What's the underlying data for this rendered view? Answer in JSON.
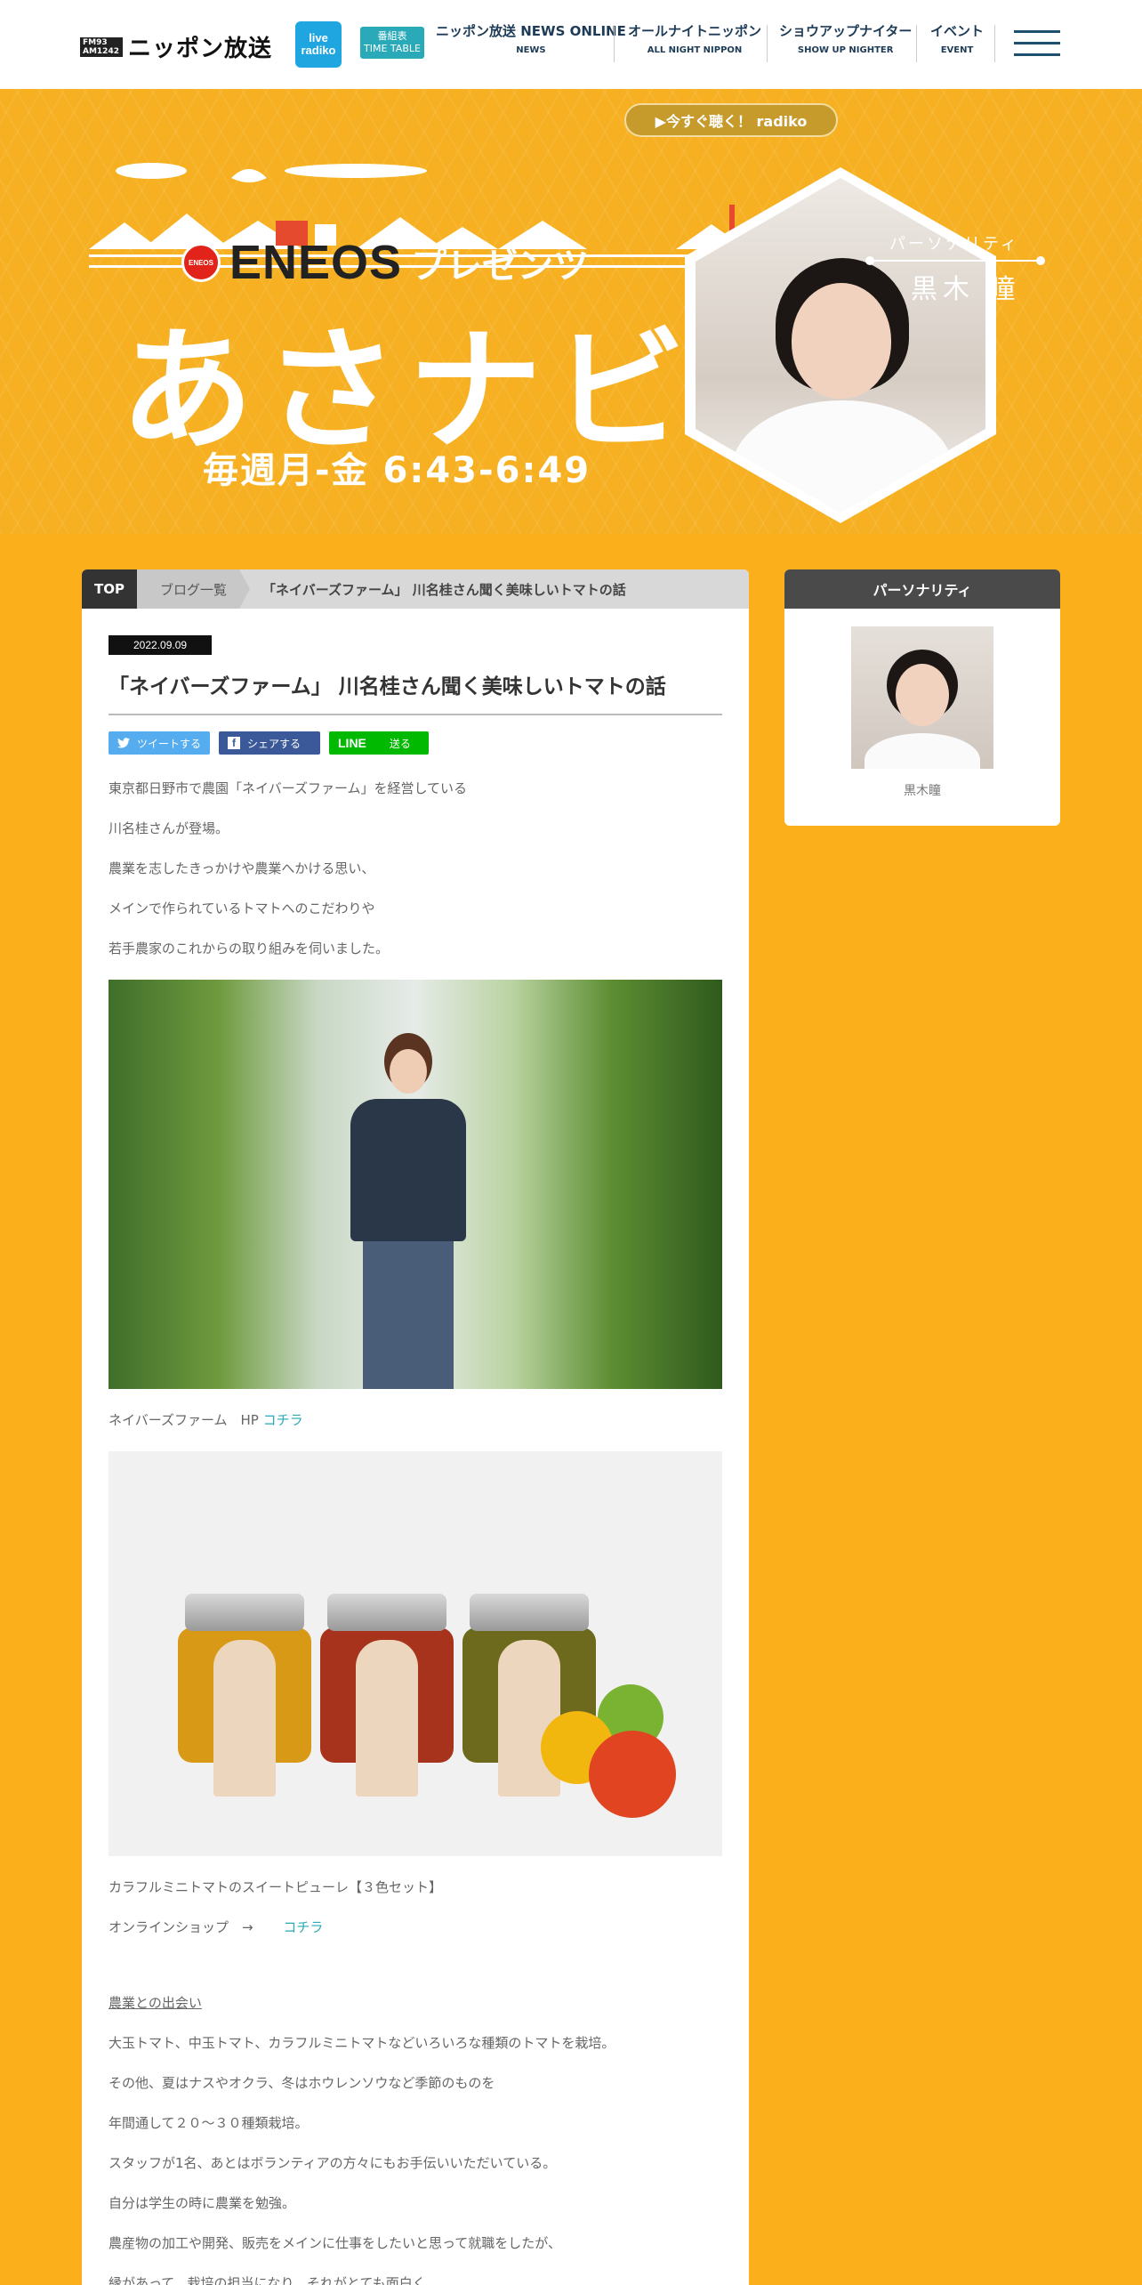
{
  "header": {
    "logo_freq": "FM93 AM1242",
    "logo_name": "ニッポン放送",
    "radiko_label": "live radiko",
    "timetable": {
      "jp": "番組表",
      "en": "TIME TABLE"
    },
    "nav": [
      {
        "jp": "ニッポン放送 NEWS ONLINE",
        "en": "NEWS"
      },
      {
        "jp": "オールナイトニッポン",
        "en": "ALL NIGHT NIPPON"
      },
      {
        "jp": "ショウアップナイター",
        "en": "SHOW UP NIGHTER"
      },
      {
        "jp": "イベント",
        "en": "EVENT"
      }
    ]
  },
  "hero": {
    "listen_button": "▶今すぐ聴く！ radiko",
    "sponsor_badge": "ENEOS",
    "sponsor": "ENEOS",
    "presents": "プレゼンツ",
    "title": "あさナビ",
    "time": "毎週月-金 6:43-6:49",
    "personality_label": "パーソナリティ",
    "personality_name": "黒木 瞳"
  },
  "breadcrumb": {
    "top": "TOP",
    "blog_list": "ブログ一覧",
    "current": "「ネイバーズファーム」 川名桂さん聞く美味しいトマトの話"
  },
  "article": {
    "date": "2022.09.09",
    "title": "「ネイバーズファーム」 川名桂さん聞く美味しいトマトの話",
    "share": {
      "twitter": "ツイートする",
      "facebook": "シェアする",
      "line": "LINE",
      "line_action": "送る"
    },
    "intro": [
      "東京都日野市で農園「ネイバーズファーム」を経営している",
      "川名桂さんが登場。",
      "農業を志したきっかけや農業へかける思い、",
      "メインで作られているトマトへのこだわりや",
      "若手農家のこれからの取り組みを伺いました。"
    ],
    "hp_text": "ネイバーズファーム　HP",
    "hp_link": "コチラ",
    "product_text": "カラフルミニトマトのスイートピューレ【３色セット】",
    "shop_text": "オンラインショップ　→　",
    "shop_link": "コチラ",
    "section_heading": "農業との出会い",
    "body": [
      "大玉トマト、中玉トマト、カラフルミニトマトなどいろいろな種類のトマトを栽培。",
      "その他、夏はナスやオクラ、冬はホウレンソウなど季節のものを",
      "年間通して２０～３０種類栽培。",
      "スタッフが1名、あとはボランティアの方々にもお手伝いいただいている。",
      "自分は学生の時に農業を勉強。",
      "農産物の加工や開発、販売をメインに仕事をしたいと思って就職をしたが、",
      "縁があって、栽培の担当になり、それがとても面白く"
    ]
  },
  "sidebar": {
    "heading": "パーソナリティ",
    "name": "黒木瞳"
  },
  "colors": {
    "background": "#fbaf1b",
    "accent": "#2aa9b8",
    "navy": "#1d3b56"
  }
}
